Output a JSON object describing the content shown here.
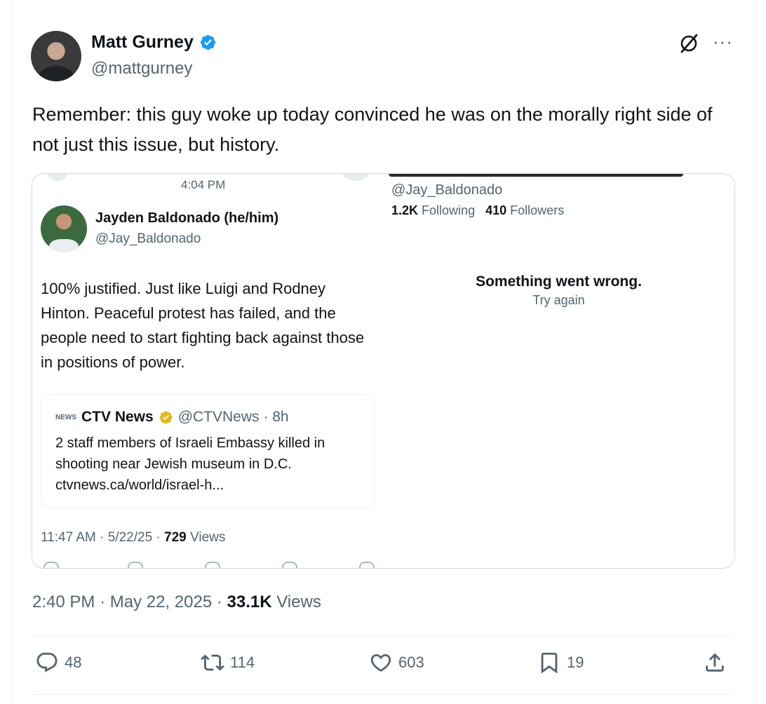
{
  "tweet": {
    "author_name": "Matt Gurney",
    "author_handle": "@mattgurney",
    "text": "Remember: this guy woke up today convinced he was on the morally right side of not just this issue, but history.",
    "time": "2:40 PM",
    "date": "May 22, 2025",
    "views_count": "33.1K",
    "views_label": "Views",
    "separator": "·"
  },
  "screenshot_left": {
    "status_time": "4:04 PM",
    "author_name": "Jayden Baldonado (he/him)",
    "author_handle": "@Jay_Baldonado",
    "text": "100% justified. Just like Luigi and Rodney Hinton. Peaceful protest has failed, and the people need to start fighting back against those in positions of power.",
    "quote": {
      "logo_text": "NEWS",
      "name": "CTV News",
      "handle_time": "@CTVNews · 8h",
      "body": "2 staff members of Israeli Embassy killed in shooting near Jewish museum in D.C. ctvnews.ca/world/israel-h..."
    },
    "meta_time": "11:47 AM · 5/22/25 · ",
    "meta_views_count": "729",
    "meta_views_label": " Views"
  },
  "screenshot_right": {
    "handle": "@Jay_Baldonado",
    "following_count": "1.2K",
    "following_label": "Following",
    "followers_count": "410",
    "followers_label": "Followers",
    "error_title": "Something went wrong.",
    "error_action": "Try again"
  },
  "actions": {
    "replies": "48",
    "reposts": "114",
    "likes": "603",
    "bookmarks": "19"
  },
  "colors": {
    "verified_blue": "#1d9bf0",
    "gold_badge": "#e2b719",
    "secondary_text": "#536471",
    "primary_text": "#0f1419"
  },
  "icons": [
    "grok-icon",
    "more-icon",
    "verified-badge-icon",
    "reply-icon",
    "repost-icon",
    "like-icon",
    "bookmark-icon",
    "share-icon"
  ]
}
